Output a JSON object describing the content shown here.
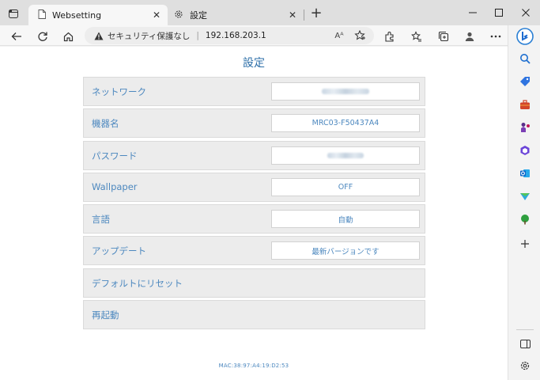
{
  "browser": {
    "tabs": [
      {
        "title": "Websetting",
        "close": "✕"
      },
      {
        "title": "設定",
        "close": "✕"
      }
    ],
    "newtab": "+",
    "address": {
      "security_text": "セキュリティ保護なし",
      "divider": "|",
      "url": "192.168.203.1",
      "read_aloud": "Aᴬ"
    }
  },
  "page": {
    "title": "設定",
    "settings": [
      {
        "label": "ネットワーク",
        "value": "",
        "obscured": true
      },
      {
        "label": "機器名",
        "value": "MRC03-F50437A4"
      },
      {
        "label": "パスワード",
        "value": "",
        "obscured": true
      },
      {
        "label": "Wallpaper",
        "value": "OFF"
      },
      {
        "label": "言語",
        "value": "自動"
      },
      {
        "label": "アップデート",
        "value": "最新バージョンです"
      },
      {
        "label": "デフォルトにリセット"
      },
      {
        "label": "再起動"
      }
    ],
    "mac": "MAC:38:97:A4:19:D2:53"
  },
  "colors": {
    "accent": "#4d88bf",
    "title": "#2d6fa8",
    "row_bg": "#ececec"
  }
}
